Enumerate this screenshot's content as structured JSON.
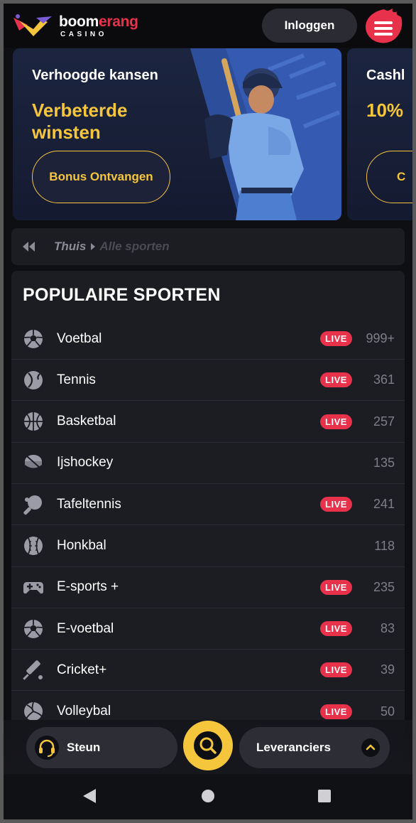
{
  "header": {
    "logo_word_1": "boom",
    "logo_word_2": "erang",
    "logo_sub": "CASINO",
    "login_label": "Inloggen"
  },
  "promo": {
    "title": "Verhoogde kansen",
    "headline": "Verbeterde winsten",
    "button_label": "Bonus Ontvangen"
  },
  "promo_next": {
    "title": "Cashl",
    "headline": "10%",
    "button_label": "C"
  },
  "breadcrumb": {
    "home": "Thuis",
    "current": "Alle sporten"
  },
  "sports": {
    "title": "POPULAIRE SPORTEN",
    "live_label": "LIVE",
    "items": [
      {
        "name": "Voetbal",
        "icon": "soccer-ball-icon",
        "live": true,
        "count": "999+"
      },
      {
        "name": "Tennis",
        "icon": "tennis-ball-icon",
        "live": true,
        "count": "361"
      },
      {
        "name": "Basketbal",
        "icon": "basketball-icon",
        "live": true,
        "count": "257"
      },
      {
        "name": "Ijshockey",
        "icon": "hockey-puck-icon",
        "live": false,
        "count": "135"
      },
      {
        "name": "Tafeltennis",
        "icon": "table-tennis-icon",
        "live": true,
        "count": "241"
      },
      {
        "name": "Honkbal",
        "icon": "baseball-icon",
        "live": false,
        "count": "118"
      },
      {
        "name": "E-sports +",
        "icon": "gamepad-icon",
        "live": true,
        "count": "235"
      },
      {
        "name": "E-voetbal",
        "icon": "soccer-ball-icon",
        "live": true,
        "count": "83"
      },
      {
        "name": "Cricket+",
        "icon": "cricket-bat-icon",
        "live": true,
        "count": "39"
      },
      {
        "name": "Volleybal",
        "icon": "volleyball-icon",
        "live": true,
        "count": "50"
      }
    ]
  },
  "bottom_nav": {
    "support_label": "Steun",
    "providers_label": "Leveranciers"
  },
  "colors": {
    "accent_yellow": "#f5c63c",
    "live_red": "#e8314a",
    "panel": "#1c1d23",
    "background": "#0e0f13"
  }
}
